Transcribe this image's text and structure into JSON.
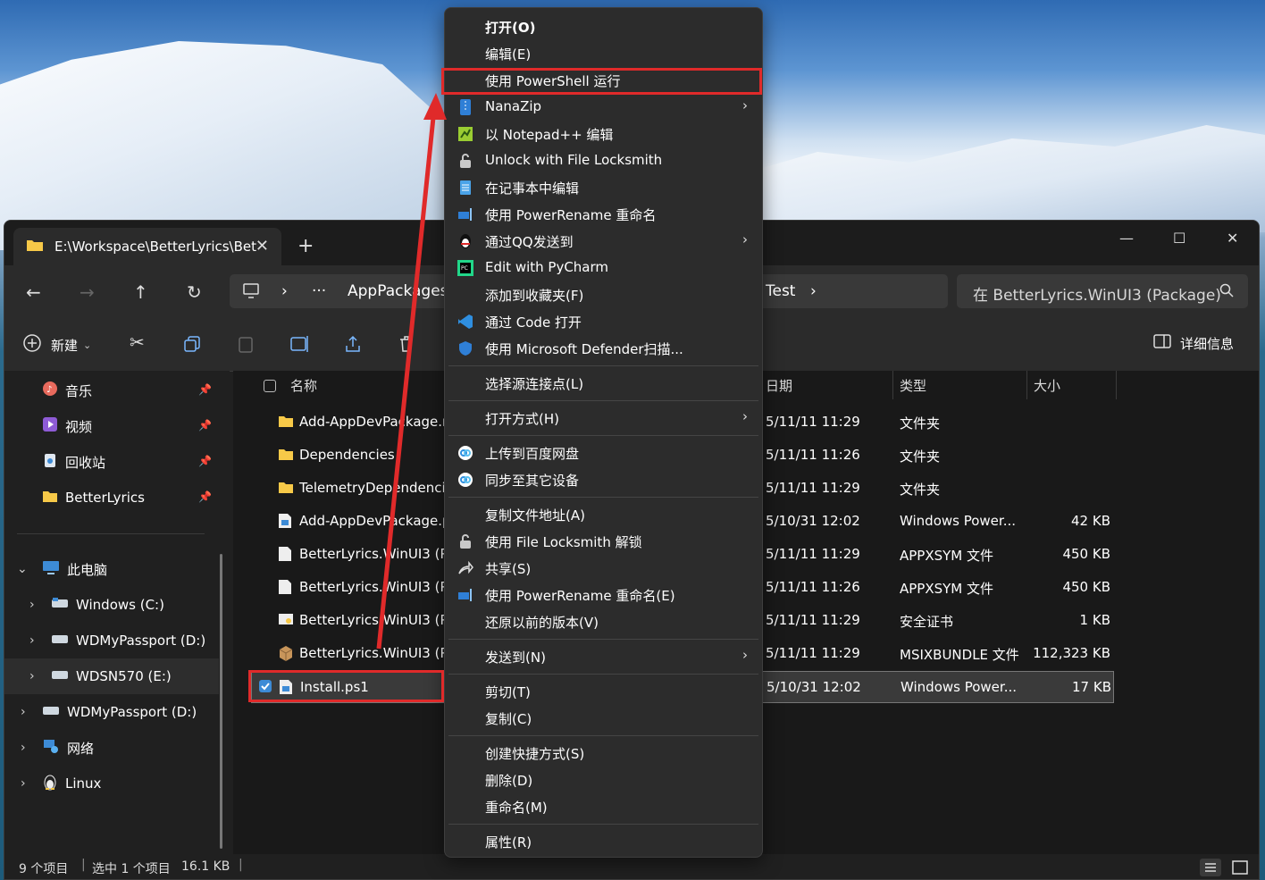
{
  "window": {
    "tab_title": "E:\\Workspace\\BetterLyrics\\Bet",
    "address": {
      "ellipsis": "···",
      "segment1": "AppPackages",
      "segment_tail": "Test"
    },
    "search_placeholder": "在 BetterLyrics.WinUI3 (Package)",
    "toolbar": {
      "new_label": "新建",
      "details_label": "详细信息"
    }
  },
  "sidebar": {
    "quick_access": [
      {
        "label": "音乐",
        "icon": "music-icon"
      },
      {
        "label": "视频",
        "icon": "video-icon"
      },
      {
        "label": "回收站",
        "icon": "recycle-bin-icon"
      },
      {
        "label": "BetterLyrics",
        "icon": "folder-icon"
      }
    ],
    "tree": [
      {
        "label": "此电脑",
        "icon": "pc-icon"
      },
      {
        "label": "Windows (C:)",
        "icon": "drive-icon"
      },
      {
        "label": "WDMyPassport (D:)",
        "icon": "drive-icon"
      },
      {
        "label": "WDSN570 (E:)",
        "icon": "drive-icon"
      },
      {
        "label": "WDMyPassport (D:)",
        "icon": "drive-icon"
      },
      {
        "label": "网络",
        "icon": "network-icon"
      },
      {
        "label": "Linux",
        "icon": "linux-icon"
      }
    ]
  },
  "columns": {
    "name": "名称",
    "date": "日期",
    "type": "类型",
    "size": "大小"
  },
  "files": [
    {
      "name": "Add-AppDevPackage.r",
      "date": "5/11/11 11:29",
      "type": "文件夹",
      "size": ""
    },
    {
      "name": "Dependencies",
      "date": "5/11/11 11:26",
      "type": "文件夹",
      "size": ""
    },
    {
      "name": "TelemetryDependencie",
      "date": "5/11/11 11:29",
      "type": "文件夹",
      "size": ""
    },
    {
      "name": "Add-AppDevPackage.p",
      "date": "5/10/31 12:02",
      "type": "Windows Power...",
      "size": "42 KB"
    },
    {
      "name": "BetterLyrics.WinUI3 (Pa",
      "date": "5/11/11 11:29",
      "type": "APPXSYM 文件",
      "size": "450 KB"
    },
    {
      "name": "BetterLyrics.WinUI3 (Pa",
      "date": "5/11/11 11:26",
      "type": "APPXSYM 文件",
      "size": "450 KB"
    },
    {
      "name": "BetterLyrics.WinUI3 (Pa",
      "date": "5/11/11 11:29",
      "type": "安全证书",
      "size": "1 KB"
    },
    {
      "name": "BetterLyrics.WinUI3 (Pa",
      "date": "5/11/11 11:29",
      "type": "MSIXBUNDLE 文件",
      "size": "112,323 KB"
    },
    {
      "name": "Install.ps1",
      "date": "5/10/31 12:02",
      "type": "Windows Power...",
      "size": "17 KB"
    }
  ],
  "status": {
    "count": "9 个项目",
    "selected": "选中 1 个项目",
    "size": "16.1 KB"
  },
  "context_menu": {
    "open": "打开(O)",
    "edit": "编辑(E)",
    "run_powershell": "使用 PowerShell 运行",
    "nanazip": "NanaZip",
    "notepadpp": "以 Notepad++ 编辑",
    "unlock_locksmith": "Unlock with File Locksmith",
    "edit_notepad": "在记事本中编辑",
    "powerrename": "使用 PowerRename 重命名",
    "send_qq": "通过QQ发送到",
    "pycharm": "Edit with PyCharm",
    "add_favorites": "添加到收藏夹(F)",
    "open_code": "通过 Code 打开",
    "defender": "使用 Microsoft Defender扫描...",
    "select_source": "选择源连接点(L)",
    "open_with": "打开方式(H)",
    "upload_baidu": "上传到百度网盘",
    "sync_devices": "同步至其它设备",
    "copy_path": "复制文件地址(A)",
    "locksmith_unlock": "使用 File Locksmith 解锁",
    "share": "共享(S)",
    "powerrename_e": "使用 PowerRename 重命名(E)",
    "restore": "还原以前的版本(V)",
    "send_to": "发送到(N)",
    "cut": "剪切(T)",
    "copy": "复制(C)",
    "create_shortcut": "创建快捷方式(S)",
    "delete": "删除(D)",
    "rename": "重命名(M)",
    "properties": "属性(R)"
  },
  "colors": {
    "highlight": "#e02a2a",
    "accent": "#3d8bd6"
  }
}
